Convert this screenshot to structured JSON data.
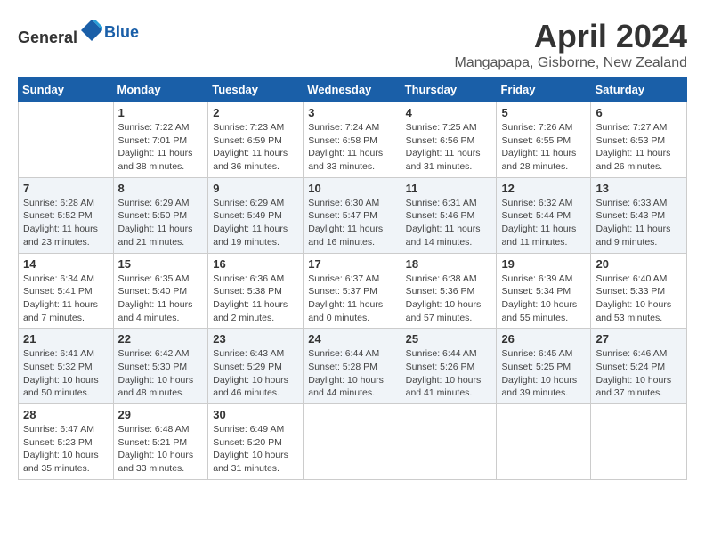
{
  "header": {
    "logo_general": "General",
    "logo_blue": "Blue",
    "month_title": "April 2024",
    "location": "Mangapapa, Gisborne, New Zealand"
  },
  "days_of_week": [
    "Sunday",
    "Monday",
    "Tuesday",
    "Wednesday",
    "Thursday",
    "Friday",
    "Saturday"
  ],
  "weeks": [
    [
      {
        "day": "",
        "info": ""
      },
      {
        "day": "1",
        "info": "Sunrise: 7:22 AM\nSunset: 7:01 PM\nDaylight: 11 hours\nand 38 minutes."
      },
      {
        "day": "2",
        "info": "Sunrise: 7:23 AM\nSunset: 6:59 PM\nDaylight: 11 hours\nand 36 minutes."
      },
      {
        "day": "3",
        "info": "Sunrise: 7:24 AM\nSunset: 6:58 PM\nDaylight: 11 hours\nand 33 minutes."
      },
      {
        "day": "4",
        "info": "Sunrise: 7:25 AM\nSunset: 6:56 PM\nDaylight: 11 hours\nand 31 minutes."
      },
      {
        "day": "5",
        "info": "Sunrise: 7:26 AM\nSunset: 6:55 PM\nDaylight: 11 hours\nand 28 minutes."
      },
      {
        "day": "6",
        "info": "Sunrise: 7:27 AM\nSunset: 6:53 PM\nDaylight: 11 hours\nand 26 minutes."
      }
    ],
    [
      {
        "day": "7",
        "info": "Sunrise: 6:28 AM\nSunset: 5:52 PM\nDaylight: 11 hours\nand 23 minutes."
      },
      {
        "day": "8",
        "info": "Sunrise: 6:29 AM\nSunset: 5:50 PM\nDaylight: 11 hours\nand 21 minutes."
      },
      {
        "day": "9",
        "info": "Sunrise: 6:29 AM\nSunset: 5:49 PM\nDaylight: 11 hours\nand 19 minutes."
      },
      {
        "day": "10",
        "info": "Sunrise: 6:30 AM\nSunset: 5:47 PM\nDaylight: 11 hours\nand 16 minutes."
      },
      {
        "day": "11",
        "info": "Sunrise: 6:31 AM\nSunset: 5:46 PM\nDaylight: 11 hours\nand 14 minutes."
      },
      {
        "day": "12",
        "info": "Sunrise: 6:32 AM\nSunset: 5:44 PM\nDaylight: 11 hours\nand 11 minutes."
      },
      {
        "day": "13",
        "info": "Sunrise: 6:33 AM\nSunset: 5:43 PM\nDaylight: 11 hours\nand 9 minutes."
      }
    ],
    [
      {
        "day": "14",
        "info": "Sunrise: 6:34 AM\nSunset: 5:41 PM\nDaylight: 11 hours\nand 7 minutes."
      },
      {
        "day": "15",
        "info": "Sunrise: 6:35 AM\nSunset: 5:40 PM\nDaylight: 11 hours\nand 4 minutes."
      },
      {
        "day": "16",
        "info": "Sunrise: 6:36 AM\nSunset: 5:38 PM\nDaylight: 11 hours\nand 2 minutes."
      },
      {
        "day": "17",
        "info": "Sunrise: 6:37 AM\nSunset: 5:37 PM\nDaylight: 11 hours\nand 0 minutes."
      },
      {
        "day": "18",
        "info": "Sunrise: 6:38 AM\nSunset: 5:36 PM\nDaylight: 10 hours\nand 57 minutes."
      },
      {
        "day": "19",
        "info": "Sunrise: 6:39 AM\nSunset: 5:34 PM\nDaylight: 10 hours\nand 55 minutes."
      },
      {
        "day": "20",
        "info": "Sunrise: 6:40 AM\nSunset: 5:33 PM\nDaylight: 10 hours\nand 53 minutes."
      }
    ],
    [
      {
        "day": "21",
        "info": "Sunrise: 6:41 AM\nSunset: 5:32 PM\nDaylight: 10 hours\nand 50 minutes."
      },
      {
        "day": "22",
        "info": "Sunrise: 6:42 AM\nSunset: 5:30 PM\nDaylight: 10 hours\nand 48 minutes."
      },
      {
        "day": "23",
        "info": "Sunrise: 6:43 AM\nSunset: 5:29 PM\nDaylight: 10 hours\nand 46 minutes."
      },
      {
        "day": "24",
        "info": "Sunrise: 6:44 AM\nSunset: 5:28 PM\nDaylight: 10 hours\nand 44 minutes."
      },
      {
        "day": "25",
        "info": "Sunrise: 6:44 AM\nSunset: 5:26 PM\nDaylight: 10 hours\nand 41 minutes."
      },
      {
        "day": "26",
        "info": "Sunrise: 6:45 AM\nSunset: 5:25 PM\nDaylight: 10 hours\nand 39 minutes."
      },
      {
        "day": "27",
        "info": "Sunrise: 6:46 AM\nSunset: 5:24 PM\nDaylight: 10 hours\nand 37 minutes."
      }
    ],
    [
      {
        "day": "28",
        "info": "Sunrise: 6:47 AM\nSunset: 5:23 PM\nDaylight: 10 hours\nand 35 minutes."
      },
      {
        "day": "29",
        "info": "Sunrise: 6:48 AM\nSunset: 5:21 PM\nDaylight: 10 hours\nand 33 minutes."
      },
      {
        "day": "30",
        "info": "Sunrise: 6:49 AM\nSunset: 5:20 PM\nDaylight: 10 hours\nand 31 minutes."
      },
      {
        "day": "",
        "info": ""
      },
      {
        "day": "",
        "info": ""
      },
      {
        "day": "",
        "info": ""
      },
      {
        "day": "",
        "info": ""
      }
    ]
  ]
}
